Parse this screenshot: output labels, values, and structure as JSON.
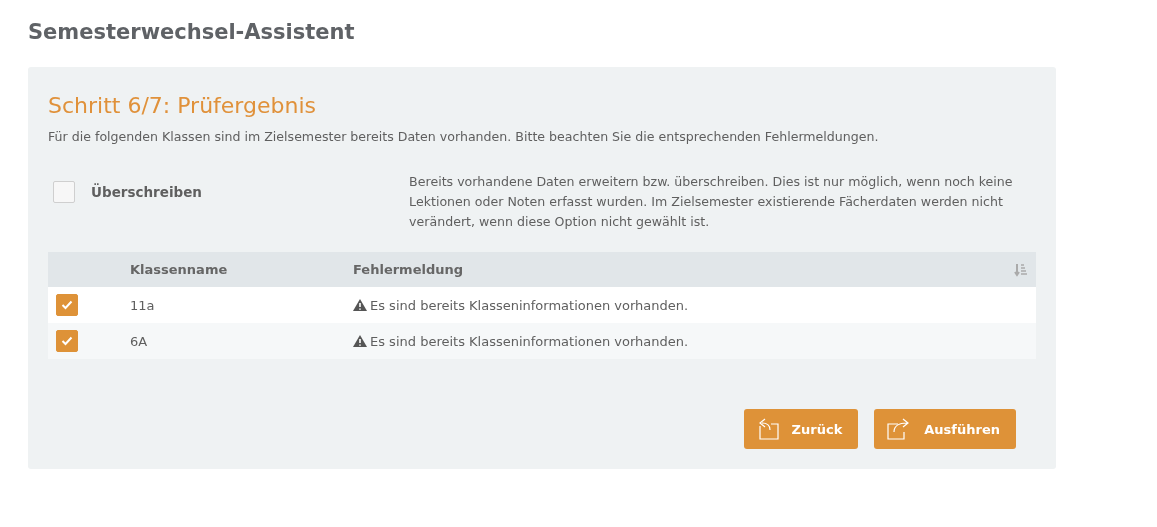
{
  "page_title": "Semesterwechsel-Assistent",
  "step": {
    "heading": "Schritt 6/7: Prüfergebnis",
    "description": "Für die folgenden Klassen sind im Zielsemester bereits Daten vorhanden. Bitte beachten Sie die entsprechenden Fehlermeldungen."
  },
  "overwrite": {
    "label": "Überschreiben",
    "checked": false,
    "help": "Bereits vorhandene Daten erweitern bzw. überschreiben. Dies ist nur möglich, wenn noch keine Lektionen oder Noten erfasst wurden. Im Zielsemester existierende Fächerdaten werden nicht verändert, wenn diese Option nicht gewählt ist."
  },
  "table": {
    "columns": [
      "Klassenname",
      "Fehlermeldung"
    ],
    "rows": [
      {
        "checked": true,
        "name": "11a",
        "message": "Es sind bereits Klasseninformationen vorhanden."
      },
      {
        "checked": true,
        "name": "6A",
        "message": "Es sind bereits Klasseninformationen vorhanden."
      }
    ]
  },
  "buttons": [
    {
      "kind": "back",
      "label": "Zurück"
    },
    {
      "kind": "forward",
      "label": "Ausführen"
    }
  ]
}
